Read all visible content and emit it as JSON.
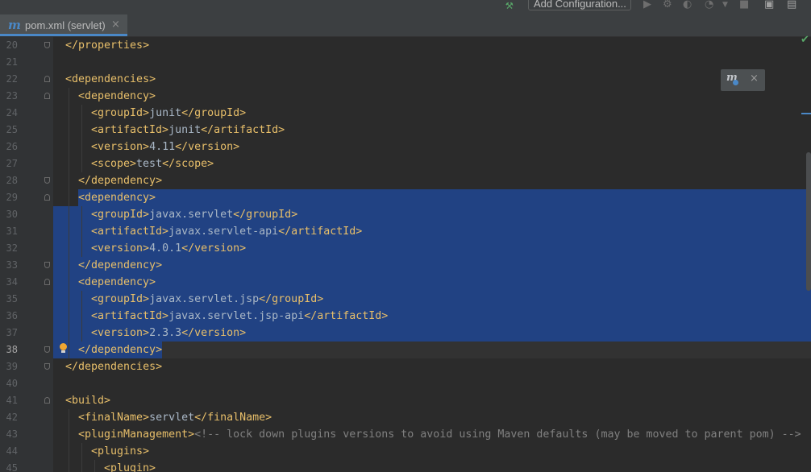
{
  "toolbar": {
    "run_config_label": "Add Configuration...",
    "icons": [
      "build-hammer-icon",
      "run-icon",
      "debug-icon",
      "coverage-icon",
      "profile-icon",
      "stop-icon",
      "project-structure-icon",
      "terminal-icon"
    ]
  },
  "tab": {
    "file_icon": "m",
    "title": "pom.xml (servlet)",
    "close": "×"
  },
  "popup": {
    "icon": "m",
    "close": "×"
  },
  "colors": {
    "background": "#2b2b2b",
    "gutter": "#313335",
    "selection": "#214283",
    "tag": "#e8bf6a",
    "text": "#a9b7c6",
    "comment": "#808080",
    "line_number": "#606366",
    "accent": "#4a88c7"
  },
  "editor": {
    "current_line": 38,
    "selection": "lines 29-38",
    "lines": [
      {
        "num": "20",
        "tokens": [
          {
            "t": "tag",
            "s": "</properties>"
          }
        ]
      },
      {
        "num": "21",
        "tokens": []
      },
      {
        "num": "22",
        "tokens": [
          {
            "t": "tag",
            "s": "<dependencies>"
          }
        ]
      },
      {
        "num": "23",
        "tokens": [
          {
            "t": "tag",
            "s": "<dependency>"
          }
        ]
      },
      {
        "num": "24",
        "tokens": [
          {
            "t": "tag",
            "s": "<groupId>"
          },
          {
            "t": "text",
            "s": "junit"
          },
          {
            "t": "tag",
            "s": "</groupId>"
          }
        ]
      },
      {
        "num": "25",
        "tokens": [
          {
            "t": "tag",
            "s": "<artifactId>"
          },
          {
            "t": "text",
            "s": "junit"
          },
          {
            "t": "tag",
            "s": "</artifactId>"
          }
        ]
      },
      {
        "num": "26",
        "tokens": [
          {
            "t": "tag",
            "s": "<version>"
          },
          {
            "t": "text",
            "s": "4.11"
          },
          {
            "t": "tag",
            "s": "</version>"
          }
        ]
      },
      {
        "num": "27",
        "tokens": [
          {
            "t": "tag",
            "s": "<scope>"
          },
          {
            "t": "text",
            "s": "test"
          },
          {
            "t": "tag",
            "s": "</scope>"
          }
        ]
      },
      {
        "num": "28",
        "tokens": [
          {
            "t": "tag",
            "s": "</dependency>"
          }
        ]
      },
      {
        "num": "29",
        "tokens": [
          {
            "t": "tag",
            "s": "<dependency>"
          }
        ]
      },
      {
        "num": "30",
        "tokens": [
          {
            "t": "tag",
            "s": "<groupId>"
          },
          {
            "t": "text",
            "s": "javax.servlet"
          },
          {
            "t": "tag",
            "s": "</groupId>"
          }
        ]
      },
      {
        "num": "31",
        "tokens": [
          {
            "t": "tag",
            "s": "<artifactId>"
          },
          {
            "t": "text",
            "s": "javax.servlet-api"
          },
          {
            "t": "tag",
            "s": "</artifactId>"
          }
        ]
      },
      {
        "num": "32",
        "tokens": [
          {
            "t": "tag",
            "s": "<version>"
          },
          {
            "t": "text",
            "s": "4.0.1"
          },
          {
            "t": "tag",
            "s": "</version>"
          }
        ]
      },
      {
        "num": "33",
        "tokens": [
          {
            "t": "tag",
            "s": "</dependency>"
          }
        ]
      },
      {
        "num": "34",
        "tokens": [
          {
            "t": "tag",
            "s": "<dependency>"
          }
        ]
      },
      {
        "num": "35",
        "tokens": [
          {
            "t": "tag",
            "s": "<groupId>"
          },
          {
            "t": "text",
            "s": "javax.servlet.jsp"
          },
          {
            "t": "tag",
            "s": "</groupId>"
          }
        ]
      },
      {
        "num": "36",
        "tokens": [
          {
            "t": "tag",
            "s": "<artifactId>"
          },
          {
            "t": "text",
            "s": "javax.servlet.jsp-api"
          },
          {
            "t": "tag",
            "s": "</artifactId>"
          }
        ]
      },
      {
        "num": "37",
        "tokens": [
          {
            "t": "tag",
            "s": "<version>"
          },
          {
            "t": "text",
            "s": "2.3.3"
          },
          {
            "t": "tag",
            "s": "</version>"
          }
        ]
      },
      {
        "num": "38",
        "tokens": [
          {
            "t": "tag",
            "s": "</dependency>"
          }
        ]
      },
      {
        "num": "39",
        "tokens": [
          {
            "t": "tag",
            "s": "</dependencies>"
          }
        ]
      },
      {
        "num": "40",
        "tokens": []
      },
      {
        "num": "41",
        "tokens": [
          {
            "t": "tag",
            "s": "<build>"
          }
        ]
      },
      {
        "num": "42",
        "tokens": [
          {
            "t": "tag",
            "s": "<finalName>"
          },
          {
            "t": "text",
            "s": "servlet"
          },
          {
            "t": "tag",
            "s": "</finalName>"
          }
        ]
      },
      {
        "num": "43",
        "tokens": [
          {
            "t": "tag",
            "s": "<pluginManagement>"
          },
          {
            "t": "comment",
            "s": "<!-- lock down plugins versions to avoid using Maven defaults (may be moved to parent pom) -->"
          }
        ]
      },
      {
        "num": "44",
        "tokens": [
          {
            "t": "tag",
            "s": "<plugins>"
          }
        ]
      },
      {
        "num": "45",
        "tokens": [
          {
            "t": "tag",
            "s": "<plugin>"
          }
        ]
      }
    ]
  }
}
